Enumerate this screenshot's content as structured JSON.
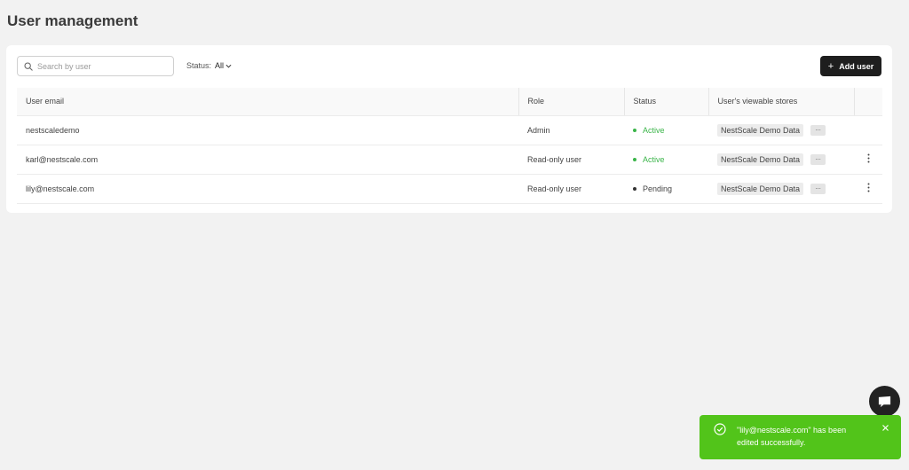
{
  "page": {
    "title": "User management"
  },
  "toolbar": {
    "search_placeholder": "Search by user",
    "status_label": "Status:",
    "status_value": "All",
    "add_user_label": "Add user"
  },
  "table": {
    "headers": [
      "User email",
      "Role",
      "Status",
      "User's viewable stores"
    ],
    "rows": [
      {
        "email": "nestscaledemo",
        "role": "Admin",
        "status": "Active",
        "store": "NestScale Demo Data",
        "more": "...",
        "has_menu": false
      },
      {
        "email": "karl@nestscale.com",
        "role": "Read-only user",
        "status": "Active",
        "store": "NestScale Demo Data",
        "more": "...",
        "has_menu": true
      },
      {
        "email": "lily@nestscale.com",
        "role": "Read-only user",
        "status": "Pending",
        "store": "NestScale Demo Data",
        "more": "...",
        "has_menu": true
      }
    ]
  },
  "toast": {
    "message": "\"lily@nestscale.com\" has been edited successfully."
  },
  "colors": {
    "accent": "#1e1e1e",
    "success": "#52c41a",
    "active_status": "#3bb54a"
  },
  "icons": {
    "search": "search-icon",
    "chevron": "chevron-down-icon",
    "plus": "plus-icon",
    "kebab": "more-vertical-icon",
    "chat": "chat-icon",
    "check": "check-circle-icon",
    "close": "close-icon"
  }
}
